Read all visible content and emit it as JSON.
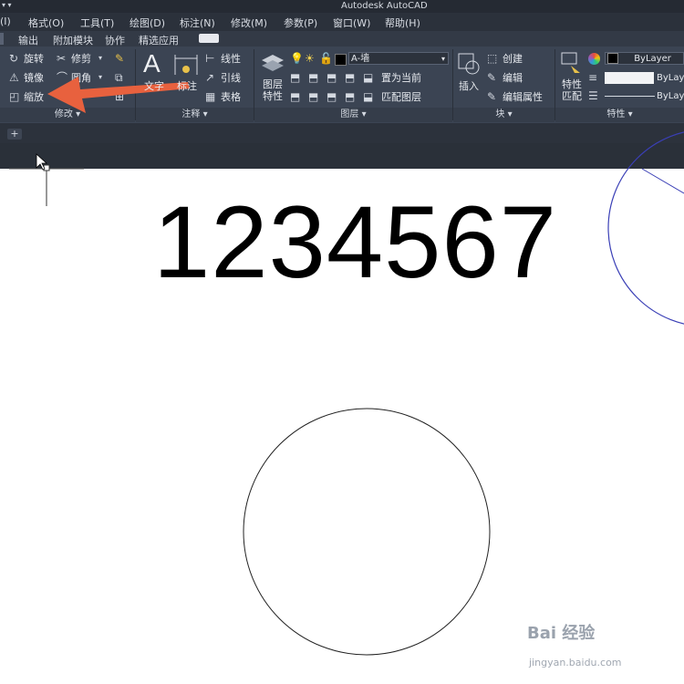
{
  "titlebar": {
    "title": "Autodesk AutoCAD",
    "qat": "▾ ▾"
  },
  "menu": [
    "(I)",
    "格式(O)",
    "工具(T)",
    "绘图(D)",
    "标注(N)",
    "修改(M)",
    "参数(P)",
    "窗口(W)",
    "帮助(H)"
  ],
  "tabs": [
    "输出",
    "附加模块",
    "协作",
    "精选应用"
  ],
  "modify": {
    "row1": [
      "旋转",
      "修剪"
    ],
    "row2": [
      "镜像",
      "圆角"
    ],
    "row3": [
      "缩放"
    ],
    "footer": "修改 ▾"
  },
  "annotation": {
    "text": "文字",
    "dim": "标注",
    "linear": "线性",
    "leader": "引线",
    "table": "表格",
    "footer": "注释 ▾"
  },
  "layers": {
    "props": "图层\n特性",
    "current": "A-墙",
    "set_current": "置为当前",
    "match": "匹配图层",
    "footer": "图层 ▾"
  },
  "block": {
    "insert": "插入",
    "create": "创建",
    "edit": "编辑",
    "edit_attr": "编辑属性",
    "footer": "块 ▾"
  },
  "properties": {
    "match": "特性\n匹配",
    "color": "ByLayer",
    "linetype": "ByLayer",
    "lineweight": "ByLayer",
    "footer": "特性 ▾"
  },
  "filetab": {
    "plus": "+"
  },
  "drawing": {
    "number": "1234567"
  },
  "watermark": {
    "logo": "Bai 经验",
    "url": "jingyan.baidu.com"
  },
  "colors": {
    "arrow": "#e8613e",
    "arc": "#3a3fb6"
  }
}
